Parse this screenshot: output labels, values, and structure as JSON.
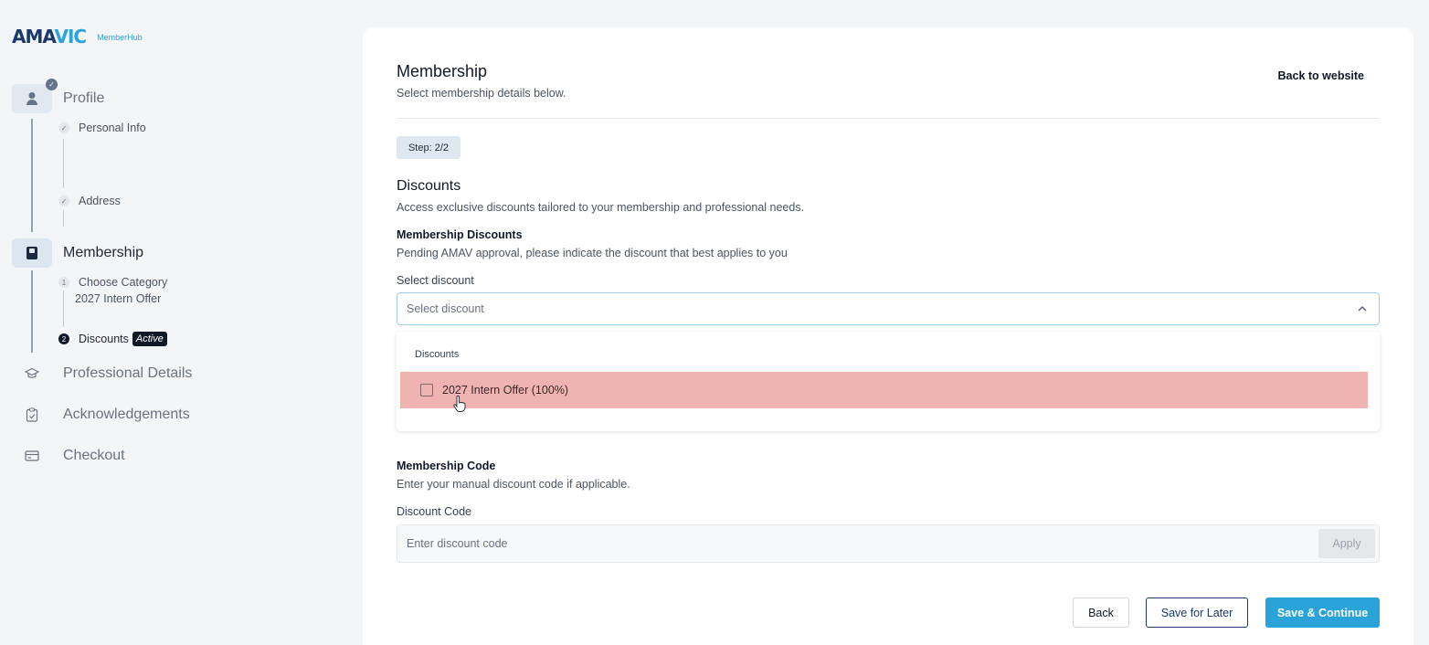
{
  "brand": {
    "logo_left": "AMA",
    "logo_right": "VIC",
    "product": "MemberHub"
  },
  "sidebar": {
    "steps": [
      {
        "label": "Profile",
        "icon": "user-icon",
        "state": "done"
      },
      {
        "label": "Membership",
        "icon": "id-card-icon",
        "state": "active"
      },
      {
        "label": "Professional Details",
        "icon": "graduation-cap-icon",
        "state": "pending"
      },
      {
        "label": "Acknowledgements",
        "icon": "clipboard-check-icon",
        "state": "pending"
      },
      {
        "label": "Checkout",
        "icon": "credit-card-icon",
        "state": "pending"
      }
    ],
    "profile_subs": [
      {
        "label": "Personal Info",
        "marker": "✓"
      },
      {
        "label": "Address",
        "marker": "✓"
      }
    ],
    "membership_subs": [
      {
        "label": "Choose Category",
        "marker": "1",
        "value": "2027 Intern Offer"
      },
      {
        "label": "Discounts",
        "marker": "2",
        "tag": "Active"
      }
    ]
  },
  "header": {
    "title": "Membership",
    "subtitle": "Select membership details below.",
    "back_link": "Back to website",
    "step": "Step: 2/2"
  },
  "discounts": {
    "title": "Discounts",
    "description": "Access exclusive discounts tailored to your membership and professional needs.",
    "membership_discounts_label": "Membership Discounts",
    "membership_discounts_desc": "Pending AMAV approval, please indicate the discount that best applies to you",
    "select_label": "Select discount",
    "select_placeholder": "Select discount",
    "dropdown_header": "Discounts",
    "options": [
      {
        "label": "2027 Intern Offer (100%)",
        "checked": false
      }
    ]
  },
  "code": {
    "title": "Membership Code",
    "description": "Enter your manual discount code if applicable.",
    "field_label": "Discount Code",
    "placeholder": "Enter discount code",
    "apply": "Apply"
  },
  "actions": {
    "back": "Back",
    "save_later": "Save for Later",
    "continue": "Save & Continue"
  },
  "colors": {
    "accent": "#2aa3d8",
    "navy": "#1b3a6b",
    "highlight": "#efb3b1"
  }
}
